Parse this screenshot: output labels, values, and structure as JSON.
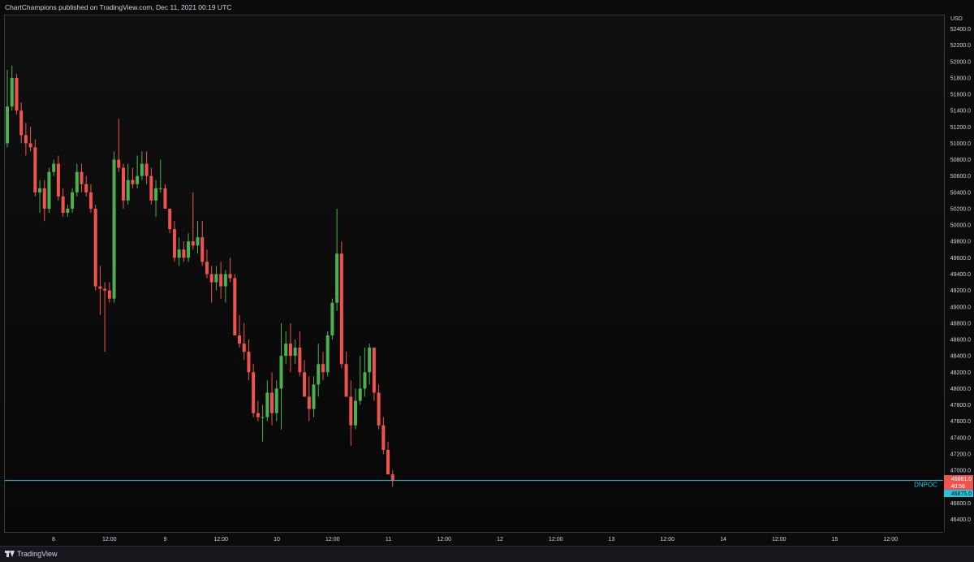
{
  "header": {
    "publisher_text": "ChartChampions published on TradingView.com, Dec 11, 2021 00:19 UTC"
  },
  "footer": {
    "brand_label": "TradingView"
  },
  "colors": {
    "up": "#26a69a",
    "up_body": "#4caf50",
    "down": "#ef5350",
    "level_line": "#26c6da",
    "background": "#0b0b0b"
  },
  "chart_data": {
    "type": "candlestick",
    "currency_label": "USD",
    "ylim": [
      46250,
      52600
    ],
    "y_ticks": [
      52400,
      52200,
      52000,
      51800,
      51600,
      51400,
      51200,
      51000,
      50800,
      50600,
      50400,
      50200,
      50000,
      49800,
      49600,
      49400,
      49200,
      49000,
      48800,
      48600,
      48400,
      48200,
      48000,
      47800,
      47600,
      47400,
      47200,
      47000,
      46600,
      46400
    ],
    "x_ticks": [
      "8",
      "12:00",
      "9",
      "12:00",
      "10",
      "12:00",
      "11",
      "12:00",
      "12",
      "12:00",
      "13",
      "12:00",
      "14",
      "12:00",
      "15",
      "12:00"
    ],
    "last_price": "46881.0",
    "countdown": "40:56",
    "level": {
      "name": "DNPOC",
      "value": 46875.0,
      "label": "46875.0"
    },
    "candles": [
      {
        "o": 51000,
        "h": 51900,
        "l": 50950,
        "c": 51450
      },
      {
        "o": 51450,
        "h": 51950,
        "l": 51400,
        "c": 51800
      },
      {
        "o": 51800,
        "h": 51850,
        "l": 51350,
        "c": 51400
      },
      {
        "o": 51400,
        "h": 51500,
        "l": 51000,
        "c": 51100
      },
      {
        "o": 51100,
        "h": 51250,
        "l": 50850,
        "c": 51000
      },
      {
        "o": 51000,
        "h": 51200,
        "l": 50900,
        "c": 50950
      },
      {
        "o": 50950,
        "h": 51050,
        "l": 50350,
        "c": 50400
      },
      {
        "o": 50400,
        "h": 50550,
        "l": 50150,
        "c": 50450
      },
      {
        "o": 50450,
        "h": 50550,
        "l": 50050,
        "c": 50200
      },
      {
        "o": 50200,
        "h": 50700,
        "l": 50150,
        "c": 50650
      },
      {
        "o": 50650,
        "h": 50800,
        "l": 50600,
        "c": 50750
      },
      {
        "o": 50750,
        "h": 50850,
        "l": 50300,
        "c": 50350
      },
      {
        "o": 50350,
        "h": 50450,
        "l": 50100,
        "c": 50150
      },
      {
        "o": 50150,
        "h": 50250,
        "l": 50100,
        "c": 50200
      },
      {
        "o": 50200,
        "h": 50450,
        "l": 50150,
        "c": 50400
      },
      {
        "o": 50400,
        "h": 50750,
        "l": 50350,
        "c": 50650
      },
      {
        "o": 50650,
        "h": 50750,
        "l": 50400,
        "c": 50500
      },
      {
        "o": 50500,
        "h": 50600,
        "l": 50350,
        "c": 50400
      },
      {
        "o": 50400,
        "h": 50500,
        "l": 50150,
        "c": 50200
      },
      {
        "o": 50200,
        "h": 50250,
        "l": 49200,
        "c": 49250
      },
      {
        "o": 49250,
        "h": 49500,
        "l": 48900,
        "c": 49220
      },
      {
        "o": 49220,
        "h": 49300,
        "l": 48450,
        "c": 49200
      },
      {
        "o": 49200,
        "h": 49300,
        "l": 49050,
        "c": 49100
      },
      {
        "o": 49100,
        "h": 50900,
        "l": 49050,
        "c": 50800
      },
      {
        "o": 50800,
        "h": 51300,
        "l": 50650,
        "c": 50700
      },
      {
        "o": 50700,
        "h": 50750,
        "l": 50200,
        "c": 50300
      },
      {
        "o": 50300,
        "h": 50750,
        "l": 50250,
        "c": 50550
      },
      {
        "o": 50550,
        "h": 50700,
        "l": 50450,
        "c": 50500
      },
      {
        "o": 50500,
        "h": 50850,
        "l": 50450,
        "c": 50600
      },
      {
        "o": 50600,
        "h": 50900,
        "l": 50550,
        "c": 50750
      },
      {
        "o": 50750,
        "h": 50900,
        "l": 50500,
        "c": 50600
      },
      {
        "o": 50600,
        "h": 50700,
        "l": 50250,
        "c": 50300
      },
      {
        "o": 50300,
        "h": 50550,
        "l": 50100,
        "c": 50450
      },
      {
        "o": 50450,
        "h": 50800,
        "l": 50400,
        "c": 50450
      },
      {
        "o": 50450,
        "h": 50500,
        "l": 50200,
        "c": 50200
      },
      {
        "o": 50200,
        "h": 50200,
        "l": 49900,
        "c": 49950
      },
      {
        "o": 49950,
        "h": 50050,
        "l": 49550,
        "c": 49600
      },
      {
        "o": 49600,
        "h": 49850,
        "l": 49500,
        "c": 49700
      },
      {
        "o": 49700,
        "h": 49800,
        "l": 49550,
        "c": 49600
      },
      {
        "o": 49600,
        "h": 49900,
        "l": 49550,
        "c": 49800
      },
      {
        "o": 49800,
        "h": 50400,
        "l": 49700,
        "c": 49750
      },
      {
        "o": 49750,
        "h": 50050,
        "l": 49650,
        "c": 49850
      },
      {
        "o": 49850,
        "h": 50050,
        "l": 49500,
        "c": 49550
      },
      {
        "o": 49550,
        "h": 49700,
        "l": 49350,
        "c": 49400
      },
      {
        "o": 49400,
        "h": 49500,
        "l": 49050,
        "c": 49300
      },
      {
        "o": 49300,
        "h": 49500,
        "l": 49200,
        "c": 49400
      },
      {
        "o": 49400,
        "h": 49550,
        "l": 49100,
        "c": 49250
      },
      {
        "o": 49250,
        "h": 49450,
        "l": 49050,
        "c": 49400
      },
      {
        "o": 49400,
        "h": 49600,
        "l": 49300,
        "c": 49350
      },
      {
        "o": 49350,
        "h": 49400,
        "l": 48650,
        "c": 48650
      },
      {
        "o": 48650,
        "h": 48900,
        "l": 48500,
        "c": 48550
      },
      {
        "o": 48550,
        "h": 48800,
        "l": 48350,
        "c": 48450
      },
      {
        "o": 48450,
        "h": 48600,
        "l": 48100,
        "c": 48200
      },
      {
        "o": 48200,
        "h": 48300,
        "l": 47650,
        "c": 47700
      },
      {
        "o": 47700,
        "h": 47850,
        "l": 47600,
        "c": 47650
      },
      {
        "o": 47650,
        "h": 47800,
        "l": 47350,
        "c": 47650
      },
      {
        "o": 47650,
        "h": 48100,
        "l": 47600,
        "c": 47950
      },
      {
        "o": 47950,
        "h": 48200,
        "l": 47550,
        "c": 47700
      },
      {
        "o": 47700,
        "h": 48100,
        "l": 47600,
        "c": 48000
      },
      {
        "o": 48000,
        "h": 48800,
        "l": 47500,
        "c": 48400
      },
      {
        "o": 48400,
        "h": 48700,
        "l": 48300,
        "c": 48550
      },
      {
        "o": 48550,
        "h": 48800,
        "l": 48200,
        "c": 48400
      },
      {
        "o": 48400,
        "h": 48600,
        "l": 48300,
        "c": 48500
      },
      {
        "o": 48500,
        "h": 48700,
        "l": 48150,
        "c": 48200
      },
      {
        "o": 48200,
        "h": 48350,
        "l": 47900,
        "c": 47900
      },
      {
        "o": 47900,
        "h": 48150,
        "l": 47600,
        "c": 47750
      },
      {
        "o": 47750,
        "h": 48150,
        "l": 47650,
        "c": 48050
      },
      {
        "o": 48050,
        "h": 48550,
        "l": 47900,
        "c": 48300
      },
      {
        "o": 48300,
        "h": 48450,
        "l": 48100,
        "c": 48200
      },
      {
        "o": 48200,
        "h": 48700,
        "l": 48150,
        "c": 48650
      },
      {
        "o": 48650,
        "h": 49100,
        "l": 48600,
        "c": 49050
      },
      {
        "o": 49050,
        "h": 50200,
        "l": 48950,
        "c": 49650
      },
      {
        "o": 49650,
        "h": 49800,
        "l": 48250,
        "c": 48300
      },
      {
        "o": 48300,
        "h": 48450,
        "l": 47900,
        "c": 47900
      },
      {
        "o": 47900,
        "h": 48100,
        "l": 47300,
        "c": 47550
      },
      {
        "o": 47550,
        "h": 48000,
        "l": 47500,
        "c": 47850
      },
      {
        "o": 47850,
        "h": 48400,
        "l": 47800,
        "c": 48000
      },
      {
        "o": 48000,
        "h": 48500,
        "l": 47900,
        "c": 48200
      },
      {
        "o": 48200,
        "h": 48550,
        "l": 48050,
        "c": 48500
      },
      {
        "o": 48500,
        "h": 48500,
        "l": 47850,
        "c": 47950
      },
      {
        "o": 47950,
        "h": 48050,
        "l": 47500,
        "c": 47550
      },
      {
        "o": 47550,
        "h": 47650,
        "l": 47200,
        "c": 47250
      },
      {
        "o": 47250,
        "h": 47350,
        "l": 46950,
        "c": 46950
      },
      {
        "o": 46950,
        "h": 47000,
        "l": 46800,
        "c": 46881
      }
    ]
  }
}
